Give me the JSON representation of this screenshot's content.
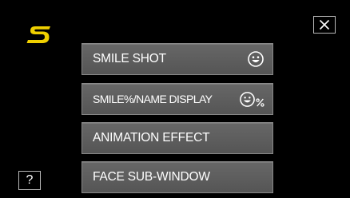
{
  "menu": {
    "items": [
      {
        "label": "SMILE SHOT",
        "icon": "smiley-face-icon"
      },
      {
        "label": "SMILE%/NAME DISPLAY",
        "icon": "smiley-face-percent-icon"
      },
      {
        "label": "ANIMATION EFFECT",
        "icon": ""
      },
      {
        "label": "FACE SUB-WINDOW",
        "icon": ""
      }
    ]
  },
  "controls": {
    "close_icon": "close-x-icon",
    "help_label": "?"
  },
  "colors": {
    "background": "#000000",
    "logo": "#f0d000",
    "button": "#606060",
    "text": "#ffffff"
  }
}
